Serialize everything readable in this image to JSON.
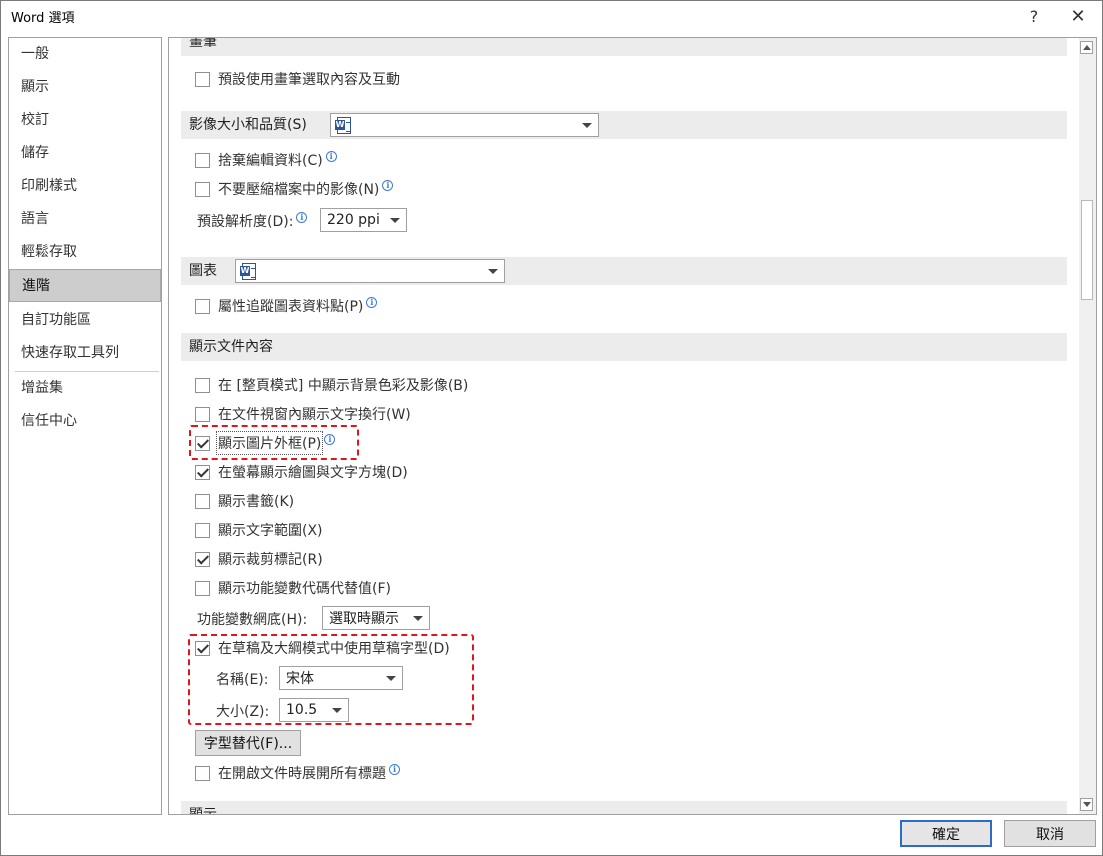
{
  "window": {
    "title": "Word 選項",
    "help": "?",
    "close": "✕"
  },
  "sidebar": {
    "items": [
      {
        "label": "一般"
      },
      {
        "label": "顯示"
      },
      {
        "label": "校訂"
      },
      {
        "label": "儲存"
      },
      {
        "label": "印刷樣式"
      },
      {
        "label": "語言"
      },
      {
        "label": "輕鬆存取"
      },
      {
        "label": "進階",
        "selected": true
      },
      {
        "label": "自訂功能區"
      },
      {
        "label": "快速存取工具列"
      },
      {
        "label": "增益集"
      },
      {
        "label": "信任中心"
      }
    ]
  },
  "pen": {
    "header": "畫筆",
    "option_pen_select": {
      "label": "預設使用畫筆選取內容及互動",
      "checked": false
    }
  },
  "image": {
    "header": "影像大小和品質(S)",
    "doc_combo": "",
    "option_discard_edit": {
      "label": "捨棄編輯資料(C)",
      "checked": false
    },
    "option_no_compress": {
      "label": "不要壓縮檔案中的影像(N)",
      "checked": false
    },
    "resolution_label": "預設解析度(D):",
    "resolution_value": "220 ppi"
  },
  "chart": {
    "header": "圖表",
    "doc_combo": "",
    "option_track_points": {
      "label": "屬性追蹤圖表資料點(P)",
      "checked": false
    }
  },
  "display": {
    "header": "顯示文件內容",
    "option_bg_colors": {
      "label": "在 [整頁模式] 中顯示背景色彩及影像(B)",
      "checked": false
    },
    "option_wrap": {
      "label": "在文件視窗內顯示文字換行(W)",
      "checked": false
    },
    "option_picture_placeholder": {
      "label": "顯示圖片外框(P)",
      "checked": true
    },
    "option_drawings": {
      "label": "在螢幕顯示繪圖與文字方塊(D)",
      "checked": true
    },
    "option_bookmarks": {
      "label": "顯示書籤(K)",
      "checked": false
    },
    "option_text_boundaries": {
      "label": "顯示文字範圍(X)",
      "checked": false
    },
    "option_crop_marks": {
      "label": "顯示裁剪標記(R)",
      "checked": true
    },
    "option_field_codes": {
      "label": "顯示功能變數代碼代替值(F)",
      "checked": false
    },
    "field_shading_label": "功能變數網底(H):",
    "field_shading_value": "選取時顯示",
    "option_draft_font": {
      "label": "在草稿及大綱模式中使用草稿字型(D)",
      "checked": true
    },
    "font_name_label": "名稱(E):",
    "font_name_value": "宋体",
    "font_size_label": "大小(Z):",
    "font_size_value": "10.5",
    "font_substitution_button": "字型替代(F)...",
    "option_expand_headings": {
      "label": "在開啟文件時展開所有標題",
      "checked": false
    }
  },
  "next_section": {
    "header": "顯示"
  },
  "footer": {
    "ok": "確定",
    "cancel": "取消"
  },
  "colors": {
    "highlight": "#e0161b",
    "selected_nav": "#cdcdcd",
    "section_bg": "#ececec",
    "accent": "#2d6bc8"
  },
  "icons": [
    "help-icon",
    "close-icon",
    "info-icon",
    "word-doc-icon",
    "chevron-down-icon",
    "scroll-up-icon",
    "scroll-down-icon"
  ]
}
